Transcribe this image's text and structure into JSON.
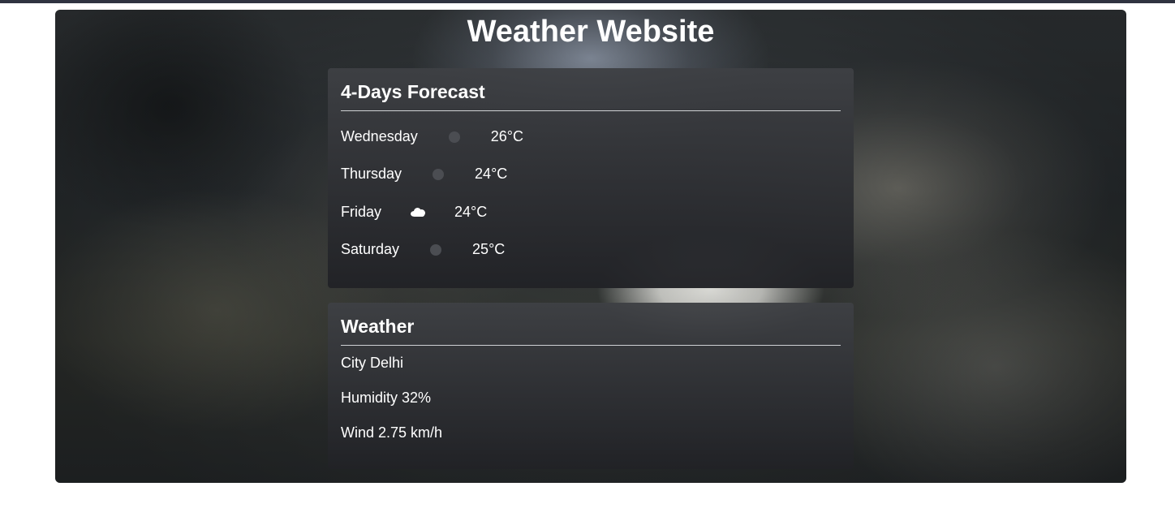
{
  "page": {
    "title": "Weather Website"
  },
  "forecast": {
    "heading": "4-Days Forecast",
    "days": [
      {
        "day": "Wednesday",
        "icon": "weather-dot-icon",
        "temp": "26°C"
      },
      {
        "day": "Thursday",
        "icon": "weather-dot-icon",
        "temp": "24°C"
      },
      {
        "day": "Friday",
        "icon": "cloud-icon",
        "temp": "24°C"
      },
      {
        "day": "Saturday",
        "icon": "weather-dot-icon",
        "temp": "25°C"
      }
    ]
  },
  "weather": {
    "heading": "Weather",
    "city": "City Delhi",
    "humidity": "Humidity 32%",
    "wind": "Wind 2.75 km/h"
  },
  "colors": {
    "topbar": "#2f3340",
    "card_top": "#3e4044",
    "card_bottom": "#212226",
    "text": "#ffffff"
  }
}
